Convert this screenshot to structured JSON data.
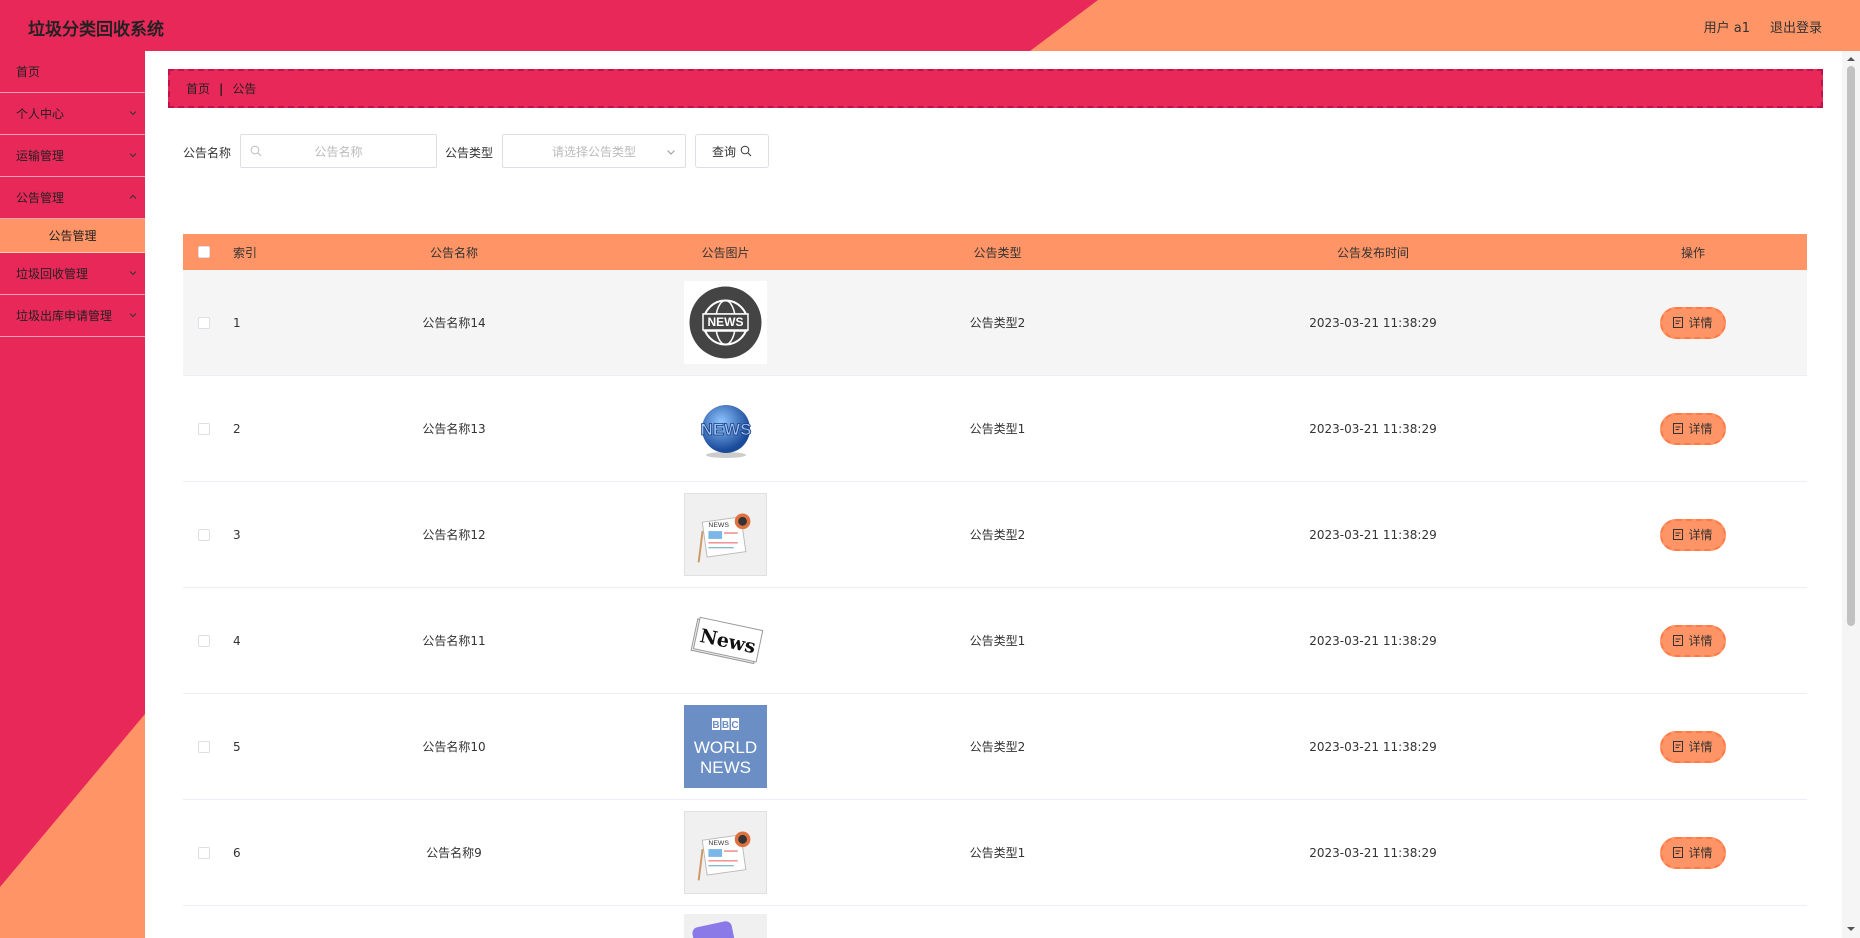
{
  "header": {
    "title": "垃圾分类回收系统",
    "user_label": "用户 a1",
    "logout_label": "退出登录"
  },
  "colors": {
    "primary": "#e9285a",
    "accent": "#ff9466"
  },
  "sidebar": {
    "items": [
      {
        "label": "首页",
        "expandable": false
      },
      {
        "label": "个人中心",
        "expandable": true
      },
      {
        "label": "运输管理",
        "expandable": true
      },
      {
        "label": "公告管理",
        "expandable": true,
        "expanded": true
      },
      {
        "label": "公告管理",
        "sub": true,
        "active": true
      },
      {
        "label": "垃圾回收管理",
        "expandable": true
      },
      {
        "label": "垃圾出库申请管理",
        "expandable": true
      }
    ]
  },
  "breadcrumb": {
    "home": "首页",
    "separator": "|",
    "current": "公告"
  },
  "search": {
    "name_label": "公告名称",
    "name_placeholder": "公告名称",
    "type_label": "公告类型",
    "type_placeholder": "请选择公告类型",
    "query_label": "查询"
  },
  "table": {
    "columns": [
      "索引",
      "公告名称",
      "公告图片",
      "公告类型",
      "公告发布时间",
      "操作"
    ],
    "detail_label": "详情",
    "rows": [
      {
        "index": "1",
        "name": "公告名称14",
        "image": "news-globe-dark",
        "type": "公告类型2",
        "time": "2023-03-21 11:38:29"
      },
      {
        "index": "2",
        "name": "公告名称13",
        "image": "news-blue-globe",
        "type": "公告类型1",
        "time": "2023-03-21 11:38:29"
      },
      {
        "index": "3",
        "name": "公告名称12",
        "image": "newspaper-coffee",
        "type": "公告类型2",
        "time": "2023-03-21 11:38:29"
      },
      {
        "index": "4",
        "name": "公告名称11",
        "image": "news-paper-stack",
        "type": "公告类型1",
        "time": "2023-03-21 11:38:29"
      },
      {
        "index": "5",
        "name": "公告名称10",
        "image": "bbc-world-news",
        "type": "公告类型2",
        "time": "2023-03-21 11:38:29"
      },
      {
        "index": "6",
        "name": "公告名称9",
        "image": "newspaper-coffee",
        "type": "公告类型1",
        "time": "2023-03-21 11:38:29"
      }
    ]
  }
}
